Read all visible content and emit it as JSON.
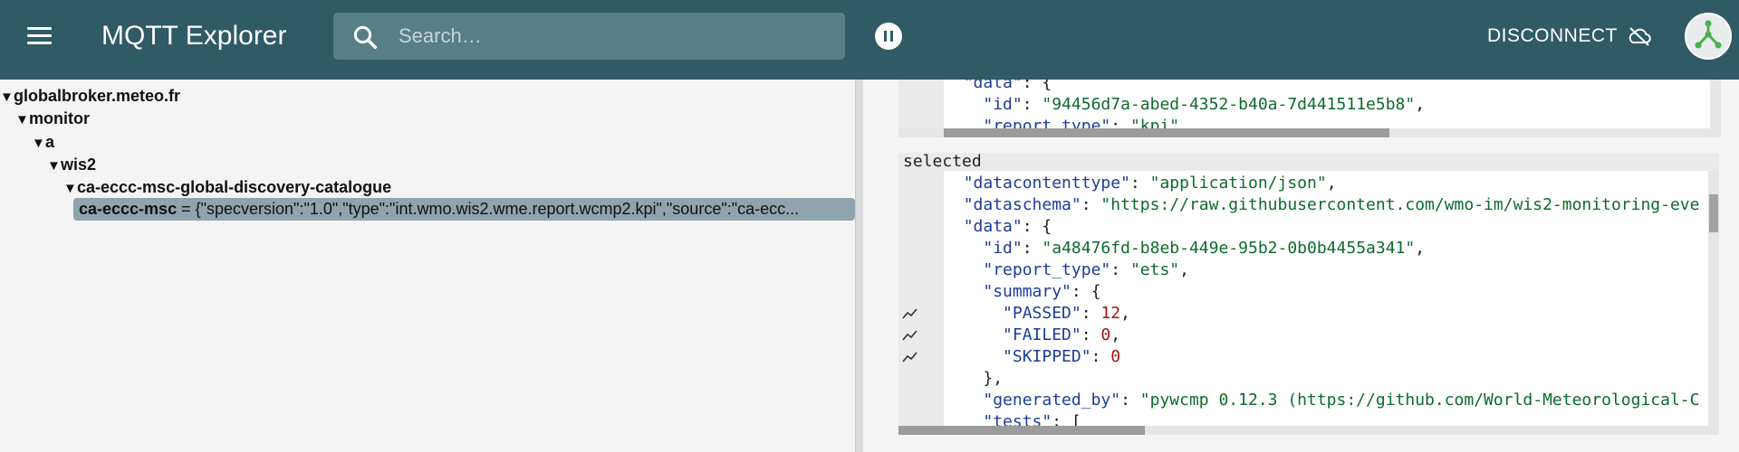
{
  "header": {
    "app_title": "MQTT Explorer",
    "search_placeholder": "Search…",
    "disconnect_label": "DISCONNECT"
  },
  "colors": {
    "appbar": "#2f5a66",
    "search_bg": "#587e88",
    "selection": "#8fa4ad",
    "json_key": "#1b3d9b",
    "json_string": "#0d6b2a",
    "json_number": "#a31515",
    "avatar_accent": "#4caf50"
  },
  "icons": {
    "menu": "menu-icon",
    "search": "search-icon",
    "pause": "pause-icon",
    "disconnect": "cloud-off-icon",
    "avatar": "network-icon",
    "chart": "chart-icon"
  },
  "tree": {
    "arrow": "▼",
    "nodes": [
      {
        "label": "globalbroker.meteo.fr"
      },
      {
        "label": "monitor"
      },
      {
        "label": "a"
      },
      {
        "label": "wis2"
      },
      {
        "label": "ca-eccc-msc-global-discovery-catalogue"
      }
    ],
    "selected": {
      "key": "ca-eccc-msc",
      "value": " = {\"specversion\":\"1.0\",\"type\":\"int.wmo.wis2.wme.report.wcmp2.kpi\",\"source\":\"ca-ecc..."
    }
  },
  "top_editor": {
    "lines": [
      {
        "indent": "  ",
        "key": "\"data\"",
        "rest": ": {"
      },
      {
        "indent": "    ",
        "key": "\"id\"",
        "sep": ": ",
        "value": "\"94456d7a-abed-4352-b40a-7d441511e5b8\"",
        "tail": ","
      },
      {
        "indent": "    ",
        "key": "\"report_type\"",
        "sep": ": ",
        "value": "\"kpi\"",
        "tail": ","
      }
    ]
  },
  "selected_panel": {
    "title": "selected",
    "lines": [
      {
        "indent": "  ",
        "key": "\"datacontenttype\"",
        "sep": ": ",
        "value": "\"application/json\"",
        "tail": ","
      },
      {
        "indent": "  ",
        "key": "\"dataschema\"",
        "sep": ": ",
        "value": "\"https://raw.githubusercontent.com/wmo-im/wis2-monitoring-eve",
        "tail": ""
      },
      {
        "indent": "  ",
        "key": "\"data\"",
        "sep": ": ",
        "value": "",
        "tail": "{"
      },
      {
        "indent": "    ",
        "key": "\"id\"",
        "sep": ": ",
        "value": "\"a48476fd-b8eb-449e-95b2-0b0b4455a341\"",
        "tail": ","
      },
      {
        "indent": "    ",
        "key": "\"report_type\"",
        "sep": ": ",
        "value": "\"ets\"",
        "tail": ","
      },
      {
        "indent": "    ",
        "key": "\"summary\"",
        "sep": ": ",
        "value": "",
        "tail": "{"
      },
      {
        "indent": "      ",
        "key": "\"PASSED\"",
        "sep": ": ",
        "num": "12",
        "tail": ","
      },
      {
        "indent": "      ",
        "key": "\"FAILED\"",
        "sep": ": ",
        "num": "0",
        "tail": ","
      },
      {
        "indent": "      ",
        "key": "\"SKIPPED\"",
        "sep": ": ",
        "num": "0",
        "tail": ""
      },
      {
        "indent": "    ",
        "key": "",
        "sep": "",
        "value": "",
        "tail": "},"
      },
      {
        "indent": "    ",
        "key": "\"generated_by\"",
        "sep": ": ",
        "value": "\"pywcmp 0.12.3 (https://github.com/World-Meteorological-C",
        "tail": ""
      },
      {
        "indent": "    ",
        "key": "\"tests\"",
        "sep": ": ",
        "value": "",
        "tail": "["
      }
    ]
  }
}
